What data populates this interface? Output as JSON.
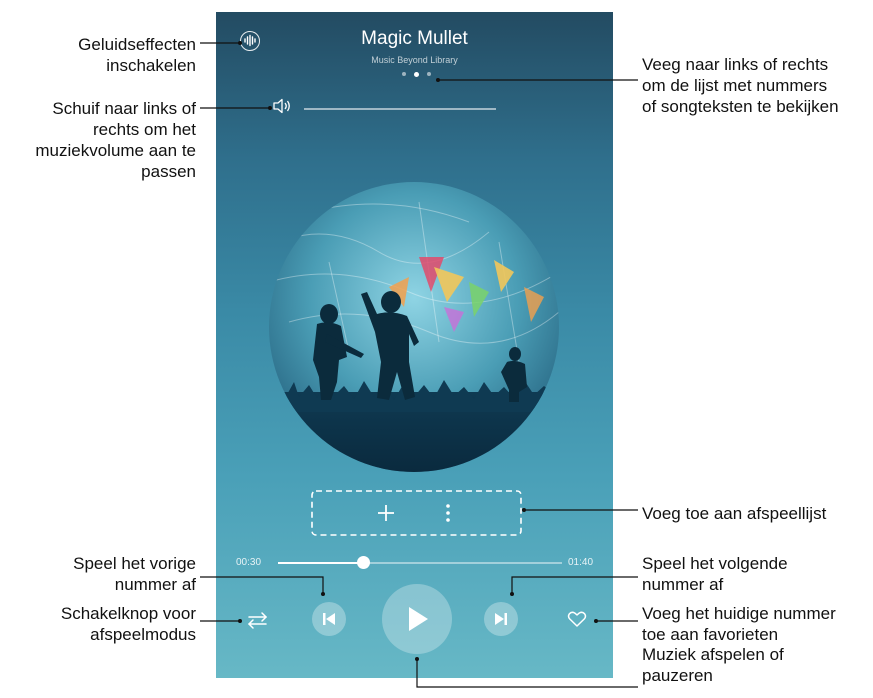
{
  "player": {
    "song_title": "Magic Mullet",
    "album": "Music Beyond Library",
    "page_dots": 3,
    "active_dot": 1,
    "volume_fraction": 0.9,
    "elapsed": "00:30",
    "duration": "01:40",
    "progress_fraction": 0.3,
    "icons": {
      "sound_effects": "sound-effects-icon",
      "volume": "speaker-icon",
      "add": "plus-icon",
      "more": "more-vertical-icon",
      "previous": "skip-previous-icon",
      "play": "play-icon",
      "next": "skip-next-icon",
      "play_mode": "shuffle-repeat-icon",
      "favorite": "heart-icon"
    }
  },
  "callouts": {
    "sound_effects": "Geluidseffecten\ninschakelen",
    "volume": "Schuif naar links of\nrechts om het\nmuziekvolume aan te\npassen",
    "swipe": "Veeg naar links of rechts\nom de lijst met nummers\nof songteksten te bekijken",
    "add_to_playlist": "Voeg toe aan afspeellijst",
    "previous": "Speel het vorige\nnummer af",
    "play_mode": "Schakelknop voor\nafspeelmodus",
    "next": "Speel het volgende\nnummer af",
    "favorite": "Voeg het huidige nummer\ntoe aan favorieten",
    "play_pause": "Muziek afspelen of\npauzeren"
  },
  "colors": {
    "accent": "#ffffff",
    "callout_line": "#111111"
  }
}
